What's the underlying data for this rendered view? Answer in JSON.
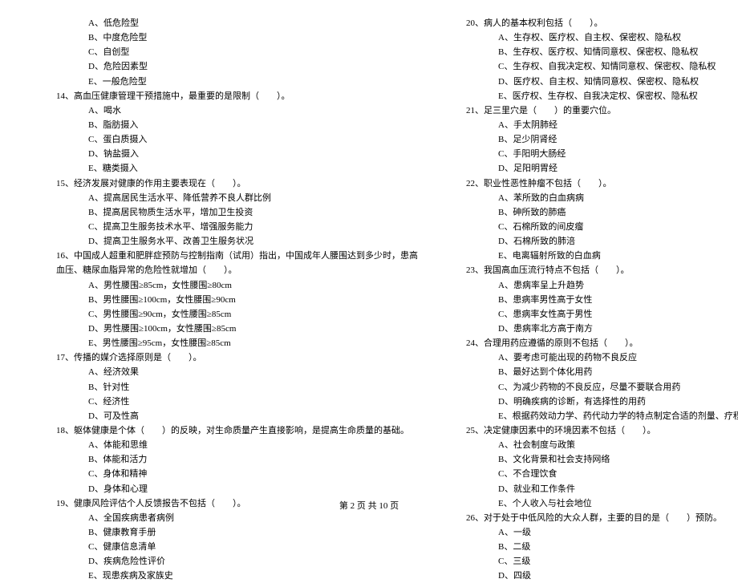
{
  "left": {
    "q13opts": [
      "A、低危险型",
      "B、中度危险型",
      "C、自创型",
      "D、危险因素型",
      "E、一般危险型"
    ],
    "q14": "14、高血压健康管理干预措施中，最重要的是限制（　　）。",
    "q14opts": [
      "A、喝水",
      "B、脂肪摄入",
      "C、蛋白质摄入",
      "D、钠盐摄入",
      "E、糖类摄入"
    ],
    "q15": "15、经济发展对健康的作用主要表现在（　　）。",
    "q15opts": [
      "A、提高居民生活水平、降低营养不良人群比例",
      "B、提高居民物质生活水平，增加卫生投资",
      "C、提高卫生服务技术水平、增强服务能力",
      "D、提高卫生服务水平、改善卫生服务状况"
    ],
    "q16": "16、中国成人超重和肥胖症预防与控制指南（试用）指出，中国成年人腰围达到多少时，患高",
    "q16cont": "血压、糖尿血脂异常的危险性就增加（　　）。",
    "q16opts": [
      "A、男性腰围≥85cm，女性腰围≥80cm",
      "B、男性腰围≥100cm，女性腰围≥90cm",
      "C、男性腰围≥90cm，女性腰围≥85cm",
      "D、男性腰围≥100cm，女性腰围≥85cm",
      "E、男性腰围≥95cm，女性腰围≥85cm"
    ],
    "q17": "17、传播的媒介选择原则是（　　）。",
    "q17opts": [
      "A、经济效果",
      "B、针对性",
      "C、经济性",
      "D、可及性高"
    ],
    "q18": "18、躯体健康是个体（　　）的反映，对生命质量产生直接影响，是提高生命质量的基础。",
    "q18opts": [
      "A、体能和思维",
      "B、体能和活力",
      "C、身体和精神",
      "D、身体和心理"
    ],
    "q19": "19、健康风险评估个人反馈报告不包括（　　）。",
    "q19opts": [
      "A、全国疾病患者病例",
      "B、健康教育手册",
      "C、健康信息清单",
      "D、疾病危险性评价",
      "E、现患疾病及家族史"
    ]
  },
  "right": {
    "q20": "20、病人的基本权利包括（　　）。",
    "q20opts": [
      "A、生存权、医疗权、自主权、保密权、隐私权",
      "B、生存权、医疗权、知情同意权、保密权、隐私权",
      "C、生存权、自我决定权、知情同意权、保密权、隐私权",
      "D、医疗权、自主权、知情同意权、保密权、隐私权",
      "E、医疗权、生存权、自我决定权、保密权、隐私权"
    ],
    "q21": "21、足三里穴是（　　）的重要穴位。",
    "q21opts": [
      "A、手太阴肺经",
      "B、足少阴肾经",
      "C、手阳明大肠经",
      "D、足阳明胃经"
    ],
    "q22": "22、职业性恶性肿瘤不包括（　　）。",
    "q22opts": [
      "A、苯所致的白血病病",
      "B、砷所致的肺癌",
      "C、石棉所致的间皮瘤",
      "D、石棉所致的肺涪",
      "E、电离辐射所致的白血病"
    ],
    "q23": "23、我国高血压流行特点不包括（　　）。",
    "q23opts": [
      "A、患病率呈上升趋势",
      "B、患病率男性高于女性",
      "C、患病率女性高于男性",
      "D、患病率北方高于南方"
    ],
    "q24": "24、合理用药应遵循的原则不包括（　　）。",
    "q24opts": [
      "A、要考虑可能出现的药物不良反应",
      "B、最好达到个体化用药",
      "C、为减少药物的不良反应，尽量不要联合用药",
      "D、明确疾病的诊断，有选择性的用药",
      "E、根据药效动力学、药代动力学的特点制定合适的剂量、疗程、给药途径"
    ],
    "q25": "25、决定健康因素中的环境因素不包括（　　）。",
    "q25opts": [
      "A、社会制度与政策",
      "B、文化背景和社会支持网络",
      "C、不合理饮食",
      "D、就业和工作条件",
      "E、个人收入与社会地位"
    ],
    "q26": "26、对于处于中低风险的大众人群，主要的目的是（　　）预防。",
    "q26opts": [
      "A、一级",
      "B、二级",
      "C、三级",
      "D、四级"
    ]
  },
  "footer": "第 2 页 共 10 页"
}
